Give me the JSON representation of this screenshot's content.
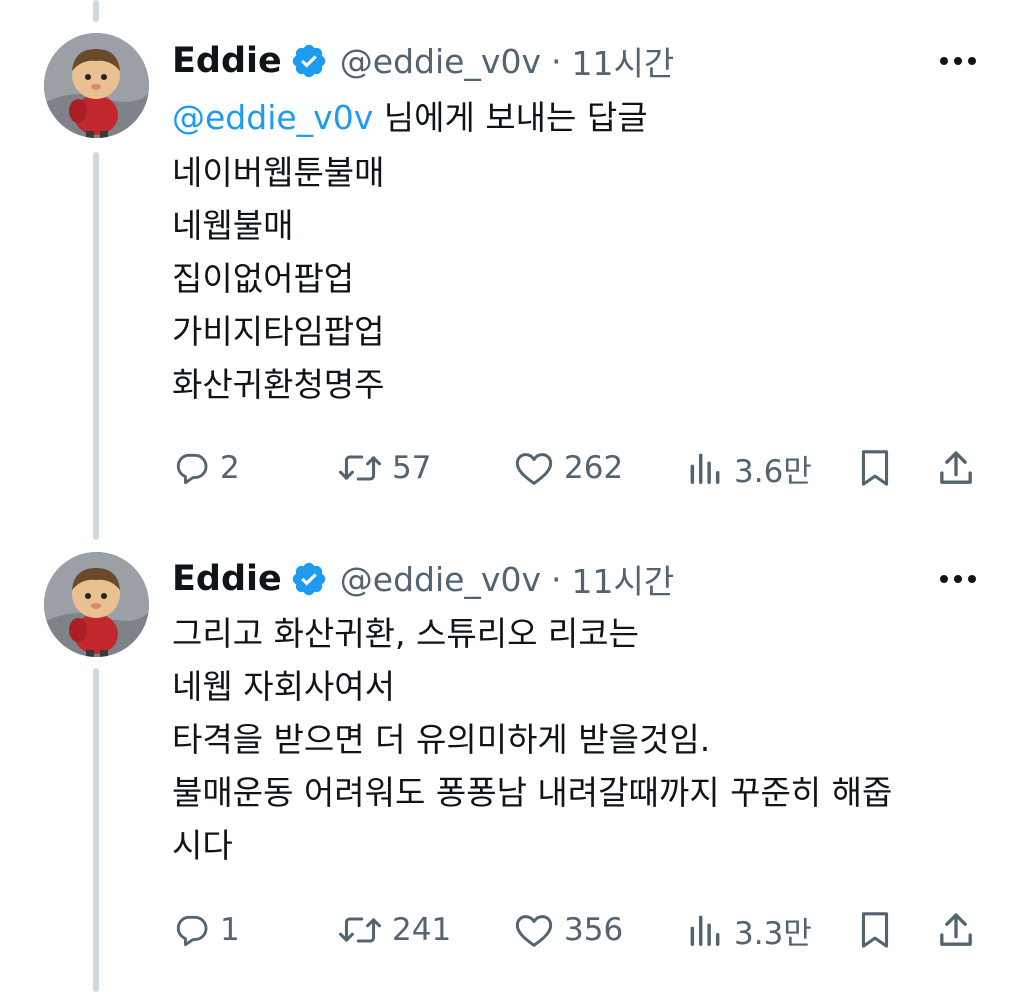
{
  "tweets": [
    {
      "author": {
        "name": "Eddie",
        "handle": "@eddie_v0v",
        "verified": true,
        "avatar": "villager-avatar"
      },
      "separator": "·",
      "time": "11시간",
      "reply_to": {
        "mention": "@eddie_v0v",
        "suffix": " 님에게 보내는 답글"
      },
      "lines": [
        "네이버웹툰불매",
        "네웹불매",
        "집이없어팝업",
        "가비지타임팝업",
        "화산귀환청명주"
      ],
      "stats": {
        "replies": "2",
        "retweets": "57",
        "likes": "262",
        "views": "3.6만"
      }
    },
    {
      "author": {
        "name": "Eddie",
        "handle": "@eddie_v0v",
        "verified": true,
        "avatar": "villager-avatar"
      },
      "separator": "·",
      "time": "11시간",
      "lines": [
        "그리고 화산귀환, 스튜리오 리코는",
        "네웹 자회사여서",
        "타격을 받으면 더 유의미하게 받을것임.",
        "불매운동 어려워도 퐁퐁남 내려갈때까지 꾸준히 해줍",
        "시다"
      ],
      "stats": {
        "replies": "1",
        "retweets": "241",
        "likes": "356",
        "views": "3.3만"
      }
    }
  ],
  "icons": {
    "reply": "reply-bubble-icon",
    "retweet": "retweet-icon",
    "like": "heart-icon",
    "views": "views-bar-chart-icon",
    "bookmark": "bookmark-icon",
    "share": "share-icon",
    "more": "more-dots-icon",
    "verified": "verified-badge-icon"
  },
  "colors": {
    "accent": "#1d9bf0",
    "text": "#0f1419",
    "muted": "#536471",
    "thread_line": "#cfd9de"
  }
}
